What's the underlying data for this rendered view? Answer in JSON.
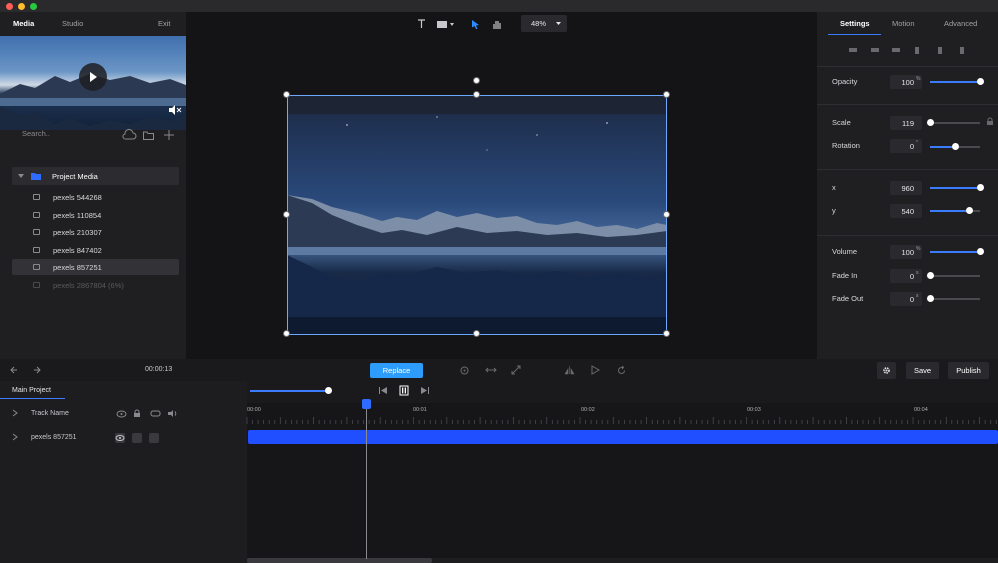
{
  "titlebar": {
    "colors": {
      "close": "#ff5f57",
      "minimize": "#febc2e",
      "maximize": "#28c840"
    }
  },
  "left_panel": {
    "tabs": [
      {
        "label": "Media"
      },
      {
        "label": "Studio"
      }
    ],
    "exit_label": "Exit",
    "search_placeholder": "Search..",
    "folder": "Project Media",
    "items": [
      {
        "label": "pexels 544268"
      },
      {
        "label": "pexels 110854"
      },
      {
        "label": "pexels 210307"
      },
      {
        "label": "pexels 847402"
      },
      {
        "label": "pexels 857251"
      },
      {
        "label": "pexels 2867804 (6%)"
      }
    ]
  },
  "toolbar": {
    "zoom": "48%"
  },
  "right_panel": {
    "tabs": [
      {
        "label": "Settings"
      },
      {
        "label": "Motion"
      },
      {
        "label": "Advanced"
      }
    ],
    "properties": {
      "opacity": {
        "label": "Opacity",
        "value": "100",
        "unit": "%",
        "level": 1.0
      },
      "scale": {
        "label": "Scale",
        "value": "119",
        "level": 0.0
      },
      "rotation": {
        "label": "Rotation",
        "value": "0",
        "unit": "°",
        "level": 0.5
      },
      "x": {
        "label": "x",
        "value": "960",
        "level": 1.0
      },
      "y": {
        "label": "y",
        "value": "540",
        "level": 0.78
      },
      "volume": {
        "label": "Volume",
        "value": "100",
        "unit": "%",
        "level": 1.0
      },
      "fade_in": {
        "label": "Fade In",
        "value": "0",
        "unit": "s",
        "level": 0.0
      },
      "fade_out": {
        "label": "Fade Out",
        "value": "0",
        "unit": "s",
        "level": 0.0
      }
    }
  },
  "bottom": {
    "time": "00:00:13",
    "replace_label": "Replace",
    "save_label": "Save",
    "publish_label": "Publish",
    "project_tab": "Main Project",
    "track_header": "Track Name",
    "track_name": "pexels 857251",
    "ruler": [
      "00:00",
      "00:01",
      "00:02",
      "00:03",
      "00:04"
    ],
    "accent": "#2d9cfa",
    "clip_color": "#1f4fff"
  }
}
